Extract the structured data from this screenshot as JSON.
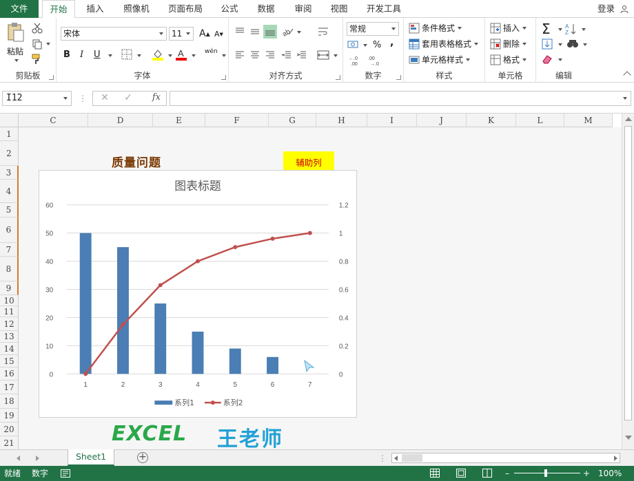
{
  "ribbon_tabs": [
    "文件",
    "开始",
    "插入",
    "照像机",
    "页面布局",
    "公式",
    "数据",
    "审阅",
    "视图",
    "开发工具"
  ],
  "login": "登录",
  "clipboard": {
    "paste": "粘贴",
    "label": "剪贴板"
  },
  "font": {
    "name": "宋体",
    "size": "11",
    "label": "字体",
    "bold": "B",
    "italic": "I",
    "underline": "U",
    "phonetic": "wén"
  },
  "alignment": {
    "label": "对齐方式"
  },
  "number": {
    "format": "常规",
    "percent": "%",
    "comma": ",",
    "label": "数字"
  },
  "styles": {
    "conditional": "条件格式",
    "table": "套用表格格式",
    "cell": "单元格样式",
    "label": "样式"
  },
  "cells": {
    "insert": "插入",
    "delete": "删除",
    "format": "格式",
    "label": "单元格"
  },
  "editing": {
    "label": "编辑"
  },
  "formula_bar": {
    "name_box": "I12",
    "fx": "fx",
    "content": ""
  },
  "columns": [
    "C",
    "D",
    "E",
    "F",
    "G",
    "H",
    "I",
    "J",
    "K",
    "L",
    "M"
  ],
  "rows": [
    "1",
    "2",
    "3",
    "4",
    "5",
    "6",
    "7",
    "8",
    "9",
    "10",
    "11",
    "12",
    "13",
    "14",
    "15",
    "16",
    "17",
    "18",
    "19",
    "20",
    "21"
  ],
  "sheet_cells": {
    "title": "质量问题",
    "helper": "辅助列",
    "brand_en": "EXCEL",
    "brand_cn": "王老师"
  },
  "chart_data": {
    "type": "bar",
    "title": "图表标题",
    "categories": [
      "1",
      "2",
      "3",
      "4",
      "5",
      "6",
      "7"
    ],
    "series": [
      {
        "name": "系列1",
        "type": "bar",
        "axis": "left",
        "values": [
          50,
          45,
          25,
          15,
          9,
          6,
          null
        ],
        "color": "#4a7eb4"
      },
      {
        "name": "系列2",
        "type": "line",
        "axis": "right",
        "values": [
          0,
          0.35,
          0.63,
          0.8,
          0.9,
          0.96,
          1
        ],
        "color": "#c0504d"
      }
    ],
    "y_left": {
      "min": 0,
      "max": 60,
      "ticks": [
        "0",
        "10",
        "20",
        "30",
        "40",
        "50",
        "60"
      ]
    },
    "y_right": {
      "min": 0,
      "max": 1.2,
      "ticks": [
        "0",
        "0.2",
        "0.4",
        "0.6",
        "0.8",
        "1",
        "1.2"
      ]
    },
    "grid": true,
    "legend": "bottom"
  },
  "sheet_tab": "Sheet1",
  "status": {
    "ready": "就绪",
    "mode": "数字",
    "zoom": "100%"
  }
}
